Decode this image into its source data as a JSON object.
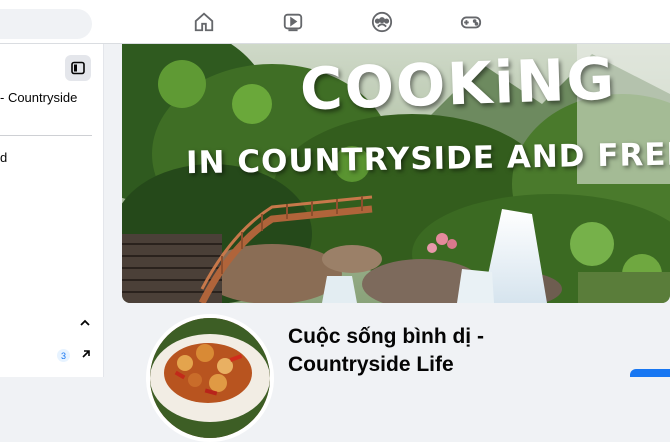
{
  "nav": {
    "icons": [
      "home-icon",
      "watch-icon",
      "groups-icon",
      "gaming-icon"
    ]
  },
  "sidebar": {
    "page_title": "- Countryside",
    "item_label": "d",
    "badge_count": "3"
  },
  "cover": {
    "title": "COOKiNG",
    "subtitle": "IN COUNTRYSIDE AND FREE LIFE"
  },
  "page": {
    "name": "Cuộc sống bình dị - Countryside Life"
  },
  "colors": {
    "accent": "#1877f2",
    "background": "#f0f2f5",
    "icon": "#65676b"
  }
}
